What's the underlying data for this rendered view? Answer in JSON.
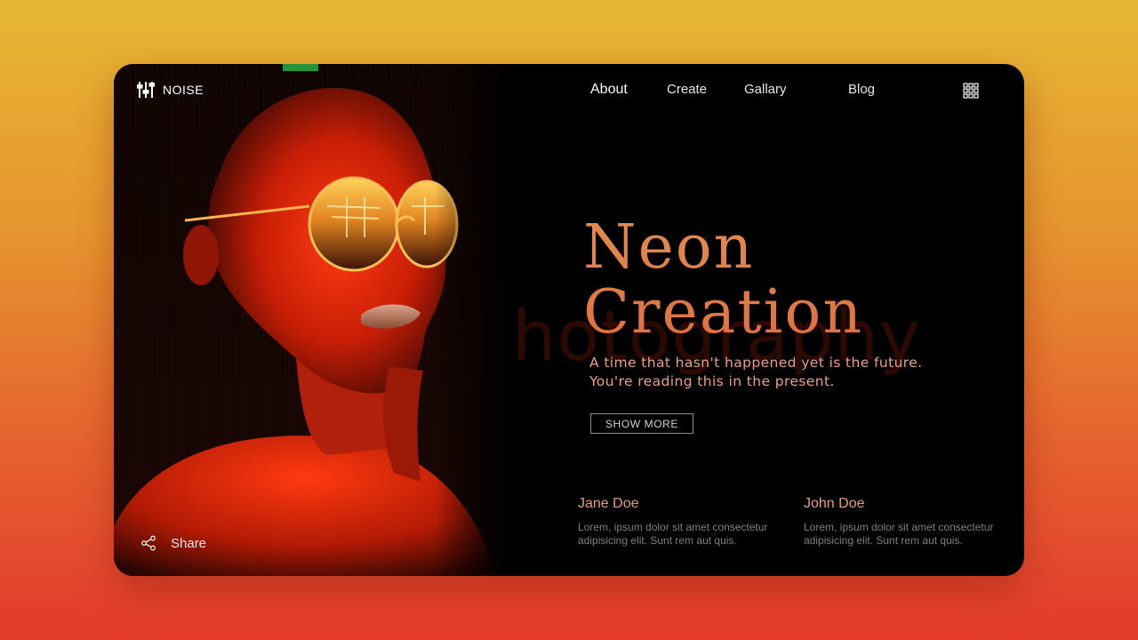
{
  "brand": {
    "name": "NOISE",
    "icon": "sliders-icon"
  },
  "nav": {
    "items": [
      {
        "label": "About",
        "active": true
      },
      {
        "label": "Create",
        "active": false
      },
      {
        "label": "Gallary",
        "active": false
      },
      {
        "label": "Blog",
        "active": false
      }
    ],
    "menu_icon": "grid-menu-icon"
  },
  "hero": {
    "watermark": "hotography",
    "title_line1": "Neon",
    "title_line2": "Creation",
    "tagline_line1": "A time that hasn't happened yet is the future.",
    "tagline_line2": "You're reading this in the present.",
    "cta_label": "SHOW MORE"
  },
  "authors": [
    {
      "name": "Jane Doe",
      "bio": "Lorem, ipsum dolor sit amet consectetur adipisicing elit. Sunt rem aut quis."
    },
    {
      "name": "John Doe",
      "bio": "Lorem, ipsum dolor sit amet consectetur adipisicing elit. Sunt rem aut quis."
    }
  ],
  "share": {
    "label": "Share",
    "icon": "share-icon"
  },
  "colors": {
    "page_gradient_top": "#e6b733",
    "page_gradient_bottom": "#e23a2c",
    "card": "#000000",
    "title": "#dd7a45",
    "tagline": "#ee9e84",
    "author_name": "#e39d7e",
    "author_bio": "#7f7f7f"
  }
}
